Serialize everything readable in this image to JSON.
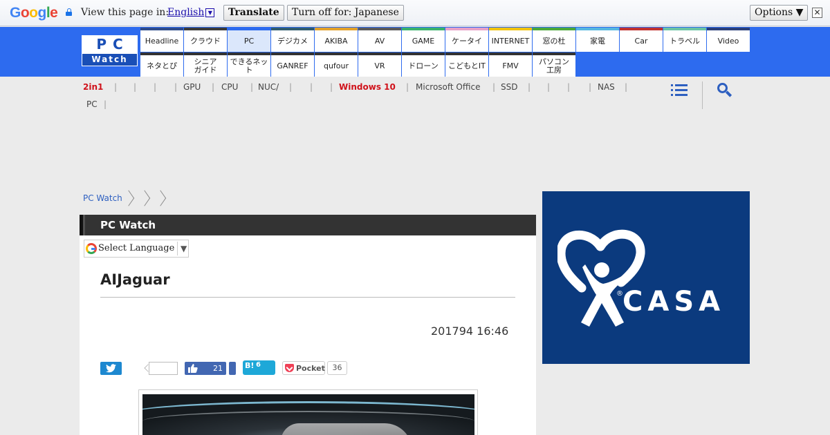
{
  "translate_bar": {
    "logo_letters": [
      {
        "ch": "G",
        "color": "#4285f4"
      },
      {
        "ch": "o",
        "color": "#ea4335"
      },
      {
        "ch": "o",
        "color": "#fbbc05"
      },
      {
        "ch": "g",
        "color": "#4285f4"
      },
      {
        "ch": "l",
        "color": "#34a853"
      },
      {
        "ch": "e",
        "color": "#ea4335"
      }
    ],
    "view_text": "View this page in:",
    "language": "English",
    "translate_label": "Translate",
    "turn_off_label": "Turn off for: Japanese",
    "options_label": "Options ▼",
    "close_label": "✕"
  },
  "header": {
    "logo_top": "PC",
    "logo_bottom": "Watch",
    "nav_row1": [
      {
        "label": "Headline",
        "color": "#2c4a8a",
        "active": false
      },
      {
        "label": "クラウド",
        "color": "#3a3a3a",
        "active": false
      },
      {
        "label": "PC",
        "color": "#2d6bef",
        "active": true
      },
      {
        "label": "デジカメ",
        "color": "#2f5b6e",
        "active": false
      },
      {
        "label": "AKIBA",
        "color": "#e2a12a",
        "active": false
      },
      {
        "label": "AV",
        "color": "#5a5a5a",
        "active": false
      },
      {
        "label": "GAME",
        "color": "#39b26b",
        "active": false
      },
      {
        "label": "ケータイ",
        "color": "#e7a1c8",
        "active": false
      },
      {
        "label": "INTERNET",
        "color": "#f1c40f",
        "active": false
      },
      {
        "label": "窓の杜",
        "color": "#4aa83a",
        "active": false
      },
      {
        "label": "家電",
        "color": "#55b7e0",
        "active": false
      },
      {
        "label": "Car",
        "color": "#c0312f",
        "active": false
      },
      {
        "label": "トラベル",
        "color": "#6bc4a4",
        "active": false
      },
      {
        "label": "Video",
        "color": "#2a3f7a",
        "active": false
      }
    ],
    "nav_row2": [
      {
        "label": "ネタとぴ",
        "color": "#333333"
      },
      {
        "label": "シニア\nガイド",
        "color": "#333333"
      },
      {
        "label": "できるネット",
        "color": "#333333"
      },
      {
        "label": "GANREF",
        "color": "#333333"
      },
      {
        "label": "qufour",
        "color": "#333333"
      },
      {
        "label": "VR",
        "color": "#333333"
      },
      {
        "label": "ドローン",
        "color": "#333333"
      },
      {
        "label": "こどもとIT",
        "color": "#333333"
      },
      {
        "label": "FMV",
        "color": "#333333"
      },
      {
        "label": "パソコン\n工房",
        "color": "#333333"
      }
    ]
  },
  "topics": {
    "row1": [
      {
        "label": "2in1",
        "red": true
      },
      {
        "label": "",
        "red": false
      },
      {
        "label": "",
        "red": false
      },
      {
        "label": "",
        "red": false
      },
      {
        "label": "GPU",
        "red": false
      },
      {
        "label": "CPU",
        "red": false
      },
      {
        "label": "NUC/",
        "red": false
      },
      {
        "label": "",
        "red": false
      },
      {
        "label": "",
        "red": false
      },
      {
        "label": "Windows 10",
        "red": true
      },
      {
        "label": "Microsoft Office",
        "red": false
      },
      {
        "label": "SSD",
        "red": false
      },
      {
        "label": "",
        "red": false
      },
      {
        "label": "",
        "red": false
      },
      {
        "label": "",
        "red": false
      },
      {
        "label": "NAS",
        "red": false
      }
    ],
    "row2": [
      {
        "label": "PC",
        "red": false
      }
    ],
    "separator": "|"
  },
  "breadcrumb": {
    "home": "PC Watch"
  },
  "article": {
    "section_title": "PC Watch",
    "select_language": "Select Language",
    "select_caret": "▼",
    "title": "AIJaguar",
    "date": "201794 16:46",
    "share": {
      "facebook_count": "21",
      "hatena_label": "B!",
      "hatena_count": "6",
      "pocket_label": "Pocket",
      "pocket_count": "36"
    }
  },
  "ad": {
    "brand": "CASA",
    "registered": "®",
    "background": "#0b3a7e"
  }
}
